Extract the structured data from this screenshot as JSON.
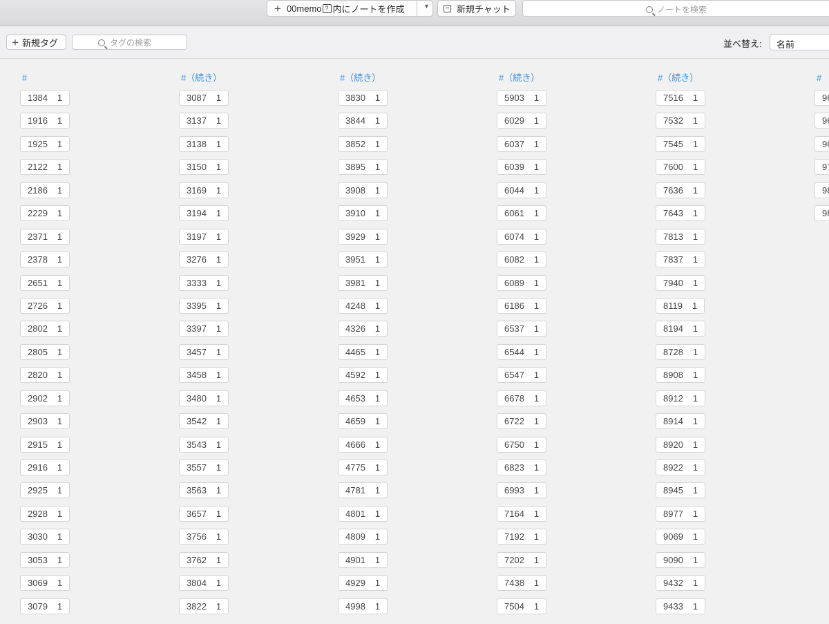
{
  "toolbar": {
    "create_note": {
      "plus": "+",
      "prefix": "00memo",
      "q": "?",
      "suffix": "内にノートを作成"
    },
    "new_chat": "新規チャット",
    "search_placeholder": "ノートを検索"
  },
  "tagbar": {
    "new_tag": "新規タグ",
    "tag_search_placeholder": "タグの検索",
    "sort_label": "並べ替え:",
    "sort_value": "名前"
  },
  "colors": {
    "accent": "#3a8ee6"
  },
  "columns": [
    {
      "header": "#",
      "tags": [
        {
          "name": "1384",
          "count": "1"
        },
        {
          "name": "1916",
          "count": "1"
        },
        {
          "name": "1925",
          "count": "1"
        },
        {
          "name": "2122",
          "count": "1"
        },
        {
          "name": "2186",
          "count": "1"
        },
        {
          "name": "2229",
          "count": "1"
        },
        {
          "name": "2371",
          "count": "1"
        },
        {
          "name": "2378",
          "count": "1"
        },
        {
          "name": "2651",
          "count": "1"
        },
        {
          "name": "2726",
          "count": "1"
        },
        {
          "name": "2802",
          "count": "1"
        },
        {
          "name": "2805",
          "count": "1"
        },
        {
          "name": "2820",
          "count": "1"
        },
        {
          "name": "2902",
          "count": "1"
        },
        {
          "name": "2903",
          "count": "1"
        },
        {
          "name": "2915",
          "count": "1"
        },
        {
          "name": "2916",
          "count": "1"
        },
        {
          "name": "2925",
          "count": "1"
        },
        {
          "name": "2928",
          "count": "1"
        },
        {
          "name": "3030",
          "count": "1"
        },
        {
          "name": "3053",
          "count": "1"
        },
        {
          "name": "3069",
          "count": "1"
        },
        {
          "name": "3079",
          "count": "1"
        }
      ]
    },
    {
      "header": "#（続き）",
      "tags": [
        {
          "name": "3087",
          "count": "1"
        },
        {
          "name": "3137",
          "count": "1"
        },
        {
          "name": "3138",
          "count": "1"
        },
        {
          "name": "3150",
          "count": "1"
        },
        {
          "name": "3169",
          "count": "1"
        },
        {
          "name": "3194",
          "count": "1"
        },
        {
          "name": "3197",
          "count": "1"
        },
        {
          "name": "3276",
          "count": "1"
        },
        {
          "name": "3333",
          "count": "1"
        },
        {
          "name": "3395",
          "count": "1"
        },
        {
          "name": "3397",
          "count": "1"
        },
        {
          "name": "3457",
          "count": "1"
        },
        {
          "name": "3458",
          "count": "1"
        },
        {
          "name": "3480",
          "count": "1"
        },
        {
          "name": "3542",
          "count": "1"
        },
        {
          "name": "3543",
          "count": "1"
        },
        {
          "name": "3557",
          "count": "1"
        },
        {
          "name": "3563",
          "count": "1"
        },
        {
          "name": "3657",
          "count": "1"
        },
        {
          "name": "3756",
          "count": "1"
        },
        {
          "name": "3762",
          "count": "1"
        },
        {
          "name": "3804",
          "count": "1"
        },
        {
          "name": "3822",
          "count": "1"
        }
      ]
    },
    {
      "header": "#（続き）",
      "tags": [
        {
          "name": "3830",
          "count": "1"
        },
        {
          "name": "3844",
          "count": "1"
        },
        {
          "name": "3852",
          "count": "1"
        },
        {
          "name": "3895",
          "count": "1"
        },
        {
          "name": "3908",
          "count": "1"
        },
        {
          "name": "3910",
          "count": "1"
        },
        {
          "name": "3929",
          "count": "1"
        },
        {
          "name": "3951",
          "count": "1"
        },
        {
          "name": "3981",
          "count": "1"
        },
        {
          "name": "4248",
          "count": "1"
        },
        {
          "name": "4326",
          "count": "1"
        },
        {
          "name": "4465",
          "count": "1"
        },
        {
          "name": "4592",
          "count": "1"
        },
        {
          "name": "4653",
          "count": "1"
        },
        {
          "name": "4659",
          "count": "1"
        },
        {
          "name": "4666",
          "count": "1"
        },
        {
          "name": "4775",
          "count": "1"
        },
        {
          "name": "4781",
          "count": "1"
        },
        {
          "name": "4801",
          "count": "1"
        },
        {
          "name": "4809",
          "count": "1"
        },
        {
          "name": "4901",
          "count": "1"
        },
        {
          "name": "4929",
          "count": "1"
        },
        {
          "name": "4998",
          "count": "1"
        }
      ]
    },
    {
      "header": "#（続き）",
      "tags": [
        {
          "name": "5903",
          "count": "1"
        },
        {
          "name": "6029",
          "count": "1"
        },
        {
          "name": "6037",
          "count": "1"
        },
        {
          "name": "6039",
          "count": "1"
        },
        {
          "name": "6044",
          "count": "1"
        },
        {
          "name": "6061",
          "count": "1"
        },
        {
          "name": "6074",
          "count": "1"
        },
        {
          "name": "6082",
          "count": "1"
        },
        {
          "name": "6089",
          "count": "1"
        },
        {
          "name": "6186",
          "count": "1"
        },
        {
          "name": "6537",
          "count": "1"
        },
        {
          "name": "6544",
          "count": "1"
        },
        {
          "name": "6547",
          "count": "1"
        },
        {
          "name": "6678",
          "count": "1"
        },
        {
          "name": "6722",
          "count": "1"
        },
        {
          "name": "6750",
          "count": "1"
        },
        {
          "name": "6823",
          "count": "1"
        },
        {
          "name": "6993",
          "count": "1"
        },
        {
          "name": "7164",
          "count": "1"
        },
        {
          "name": "7192",
          "count": "1"
        },
        {
          "name": "7202",
          "count": "1"
        },
        {
          "name": "7438",
          "count": "1"
        },
        {
          "name": "7504",
          "count": "1"
        }
      ]
    },
    {
      "header": "#（続き）",
      "tags": [
        {
          "name": "7516",
          "count": "1"
        },
        {
          "name": "7532",
          "count": "1"
        },
        {
          "name": "7545",
          "count": "1"
        },
        {
          "name": "7600",
          "count": "1"
        },
        {
          "name": "7636",
          "count": "1"
        },
        {
          "name": "7643",
          "count": "1"
        },
        {
          "name": "7813",
          "count": "1"
        },
        {
          "name": "7837",
          "count": "1"
        },
        {
          "name": "7940",
          "count": "1"
        },
        {
          "name": "8119",
          "count": "1"
        },
        {
          "name": "8194",
          "count": "1"
        },
        {
          "name": "8728",
          "count": "1"
        },
        {
          "name": "8908",
          "count": "1"
        },
        {
          "name": "8912",
          "count": "1"
        },
        {
          "name": "8914",
          "count": "1"
        },
        {
          "name": "8920",
          "count": "1"
        },
        {
          "name": "8922",
          "count": "1"
        },
        {
          "name": "8945",
          "count": "1"
        },
        {
          "name": "8977",
          "count": "1"
        },
        {
          "name": "9069",
          "count": "1"
        },
        {
          "name": "9090",
          "count": "1"
        },
        {
          "name": "9432",
          "count": "1"
        },
        {
          "name": "9433",
          "count": "1"
        }
      ]
    },
    {
      "header": "#",
      "tags": [
        {
          "name": "96",
          "count": ""
        },
        {
          "name": "96",
          "count": ""
        },
        {
          "name": "96",
          "count": ""
        },
        {
          "name": "97",
          "count": ""
        },
        {
          "name": "98",
          "count": ""
        },
        {
          "name": "98",
          "count": ""
        }
      ]
    }
  ]
}
